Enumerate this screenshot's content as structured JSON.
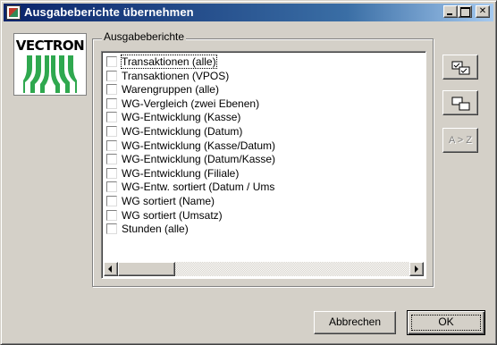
{
  "window": {
    "title": "Ausgabeberichte übernehmen",
    "title_bar_colors": [
      "#0a246a",
      "#a6caf0"
    ]
  },
  "logo": {
    "text": "VECTRON",
    "mark_color": "#2fa84f"
  },
  "group": {
    "label": "Ausgabeberichte"
  },
  "list": {
    "items": [
      {
        "label": "Transaktionen (alle)",
        "checked": false,
        "focused": true
      },
      {
        "label": "Transaktionen (VPOS)",
        "checked": false
      },
      {
        "label": "Warengruppen (alle)",
        "checked": false
      },
      {
        "label": "WG-Vergleich (zwei Ebenen)",
        "checked": false
      },
      {
        "label": "WG-Entwicklung (Kasse)",
        "checked": false
      },
      {
        "label": "WG-Entwicklung (Datum)",
        "checked": false
      },
      {
        "label": "WG-Entwicklung (Kasse/Datum)",
        "checked": false
      },
      {
        "label": "WG-Entwicklung (Datum/Kasse)",
        "checked": false
      },
      {
        "label": "WG-Entwicklung (Filiale)",
        "checked": false
      },
      {
        "label": "WG-Entw. sortiert (Datum / Ums",
        "checked": false
      },
      {
        "label": "WG sortiert (Name)",
        "checked": false
      },
      {
        "label": "WG sortiert (Umsatz)",
        "checked": false
      },
      {
        "label": "Stunden (alle)",
        "checked": false
      }
    ],
    "horizontal_scroll_position": 0
  },
  "tools": {
    "select_all_icon": "select-all-icon",
    "copy_icon": "copy-icon",
    "sort_label": "A > Z"
  },
  "buttons": {
    "cancel": "Abbrechen",
    "ok": "OK"
  }
}
